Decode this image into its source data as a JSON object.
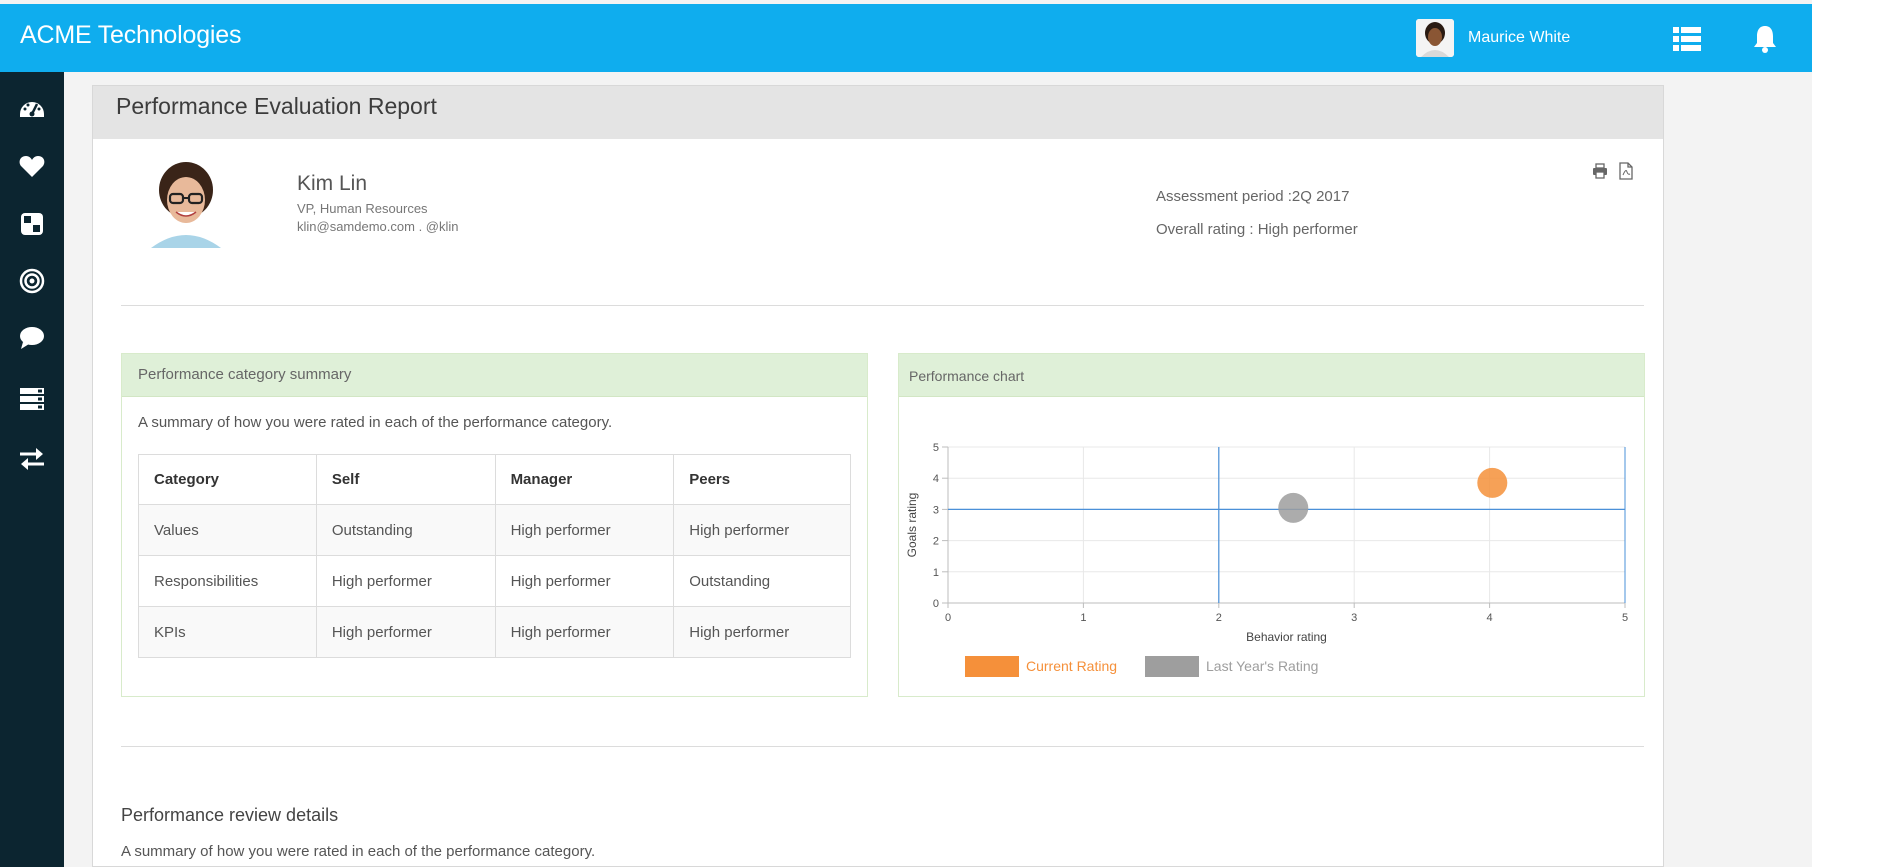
{
  "app": {
    "brand": "ACME Technologies",
    "user_name": "Maurice White",
    "accent_color": "#0fadee",
    "sidebar_color": "#0c2530"
  },
  "sidebar": {
    "items": [
      {
        "name": "dashboard-icon"
      },
      {
        "name": "heart-icon"
      },
      {
        "name": "grid-icon"
      },
      {
        "name": "target-icon"
      },
      {
        "name": "chat-icon"
      },
      {
        "name": "list-icon"
      },
      {
        "name": "transfer-icon"
      }
    ]
  },
  "page": {
    "title": "Performance Evaluation Report"
  },
  "profile": {
    "name": "Kim Lin",
    "role": "VP, Human Resources",
    "contact": "klin@samdemo.com . @klin",
    "assessment_period": "Assessment period :2Q 2017",
    "overall_rating": "Overall rating : High performer"
  },
  "summary": {
    "heading": "Performance category summary",
    "description": "A summary of how you were rated in each of the performance category.",
    "columns": [
      "Category",
      "Self",
      "Manager",
      "Peers"
    ],
    "rows": [
      [
        "Values",
        "Outstanding",
        "High performer",
        "High performer"
      ],
      [
        "Responsibilities",
        "High performer",
        "High performer",
        "Outstanding"
      ],
      [
        "KPIs",
        "High performer",
        "High performer",
        "High performer"
      ]
    ]
  },
  "chart_panel": {
    "heading": "Performance chart"
  },
  "chart_data": {
    "type": "scatter",
    "xlabel": "Behavior rating",
    "ylabel": "Goals rating",
    "xlim": [
      0,
      5
    ],
    "ylim": [
      0,
      5
    ],
    "xticks": [
      "0",
      "1",
      "2",
      "3",
      "4",
      "5"
    ],
    "yticks": [
      "0",
      "1",
      "2",
      "3",
      "4",
      "5"
    ],
    "grid": true,
    "reference_lines": {
      "x": 2,
      "y": 3
    },
    "legend_position": "bottom",
    "series": [
      {
        "name": "Current Rating",
        "color": "#f5903a",
        "points": [
          {
            "x": 4.02,
            "y": 3.85
          }
        ]
      },
      {
        "name": "Last Year's Rating",
        "color": "#9e9e9e",
        "points": [
          {
            "x": 2.55,
            "y": 3.05
          }
        ]
      }
    ]
  },
  "details": {
    "title": "Performance review details",
    "description": "A summary of how you were rated in each of the performance category."
  }
}
